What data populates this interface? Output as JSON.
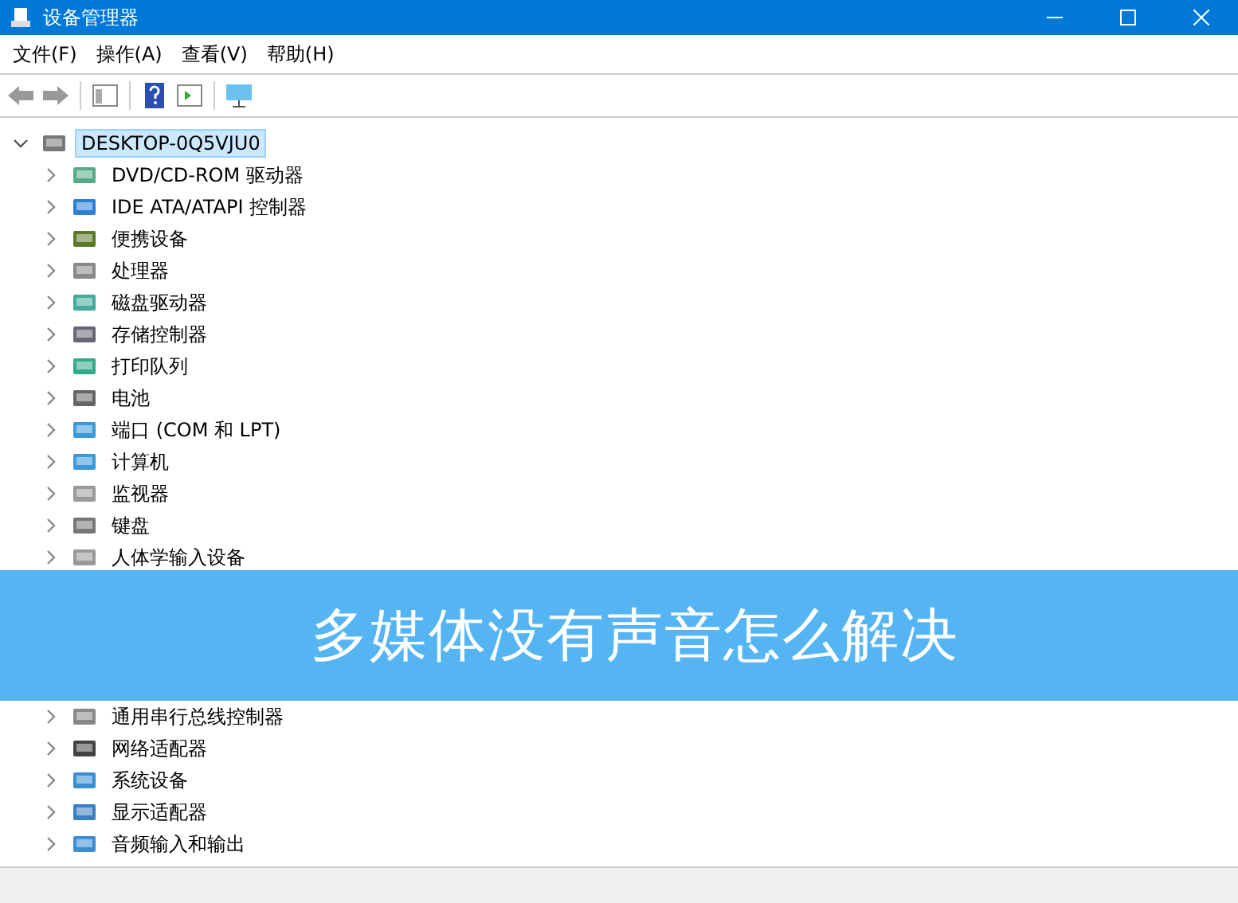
{
  "window": {
    "title": "设备管理器"
  },
  "menu": [
    "文件(F)",
    "操作(A)",
    "查看(V)",
    "帮助(H)"
  ],
  "tree": {
    "label": "DESKTOP-0Q5VJU0",
    "expanded": true,
    "selected": true,
    "children": [
      {
        "label": "DVD/CD-ROM 驱动器",
        "expanded": false,
        "selected": false
      },
      {
        "label": "IDE ATA/ATAPI 控制器",
        "expanded": false,
        "selected": false
      },
      {
        "label": "便携设备",
        "expanded": false,
        "selected": false
      },
      {
        "label": "处理器",
        "expanded": false,
        "selected": false
      },
      {
        "label": "磁盘驱动器",
        "expanded": false,
        "selected": false
      },
      {
        "label": "存储控制器",
        "expanded": false,
        "selected": false
      },
      {
        "label": "打印队列",
        "expanded": false,
        "selected": false
      },
      {
        "label": "电池",
        "expanded": false,
        "selected": false
      },
      {
        "label": "端口 (COM 和 LPT)",
        "expanded": false,
        "selected": false
      },
      {
        "label": "计算机",
        "expanded": false,
        "selected": false
      },
      {
        "label": "监视器",
        "expanded": false,
        "selected": false
      },
      {
        "label": "键盘",
        "expanded": false,
        "selected": false
      },
      {
        "label": "人体学输入设备",
        "expanded": false,
        "selected": false
      }
    ]
  },
  "banner": {
    "title": "多媒体没有声音怎么解决"
  },
  "tree_below_banner": [
    {
      "label": "通用串行总线控制器",
      "expanded": false,
      "selected": false
    },
    {
      "label": "网络适配器",
      "expanded": false,
      "selected": false
    },
    {
      "label": "系统设备",
      "expanded": false,
      "selected": false
    },
    {
      "label": "显示适配器",
      "expanded": false,
      "selected": false
    },
    {
      "label": "音频输入和输出",
      "expanded": false,
      "selected": false
    }
  ]
}
